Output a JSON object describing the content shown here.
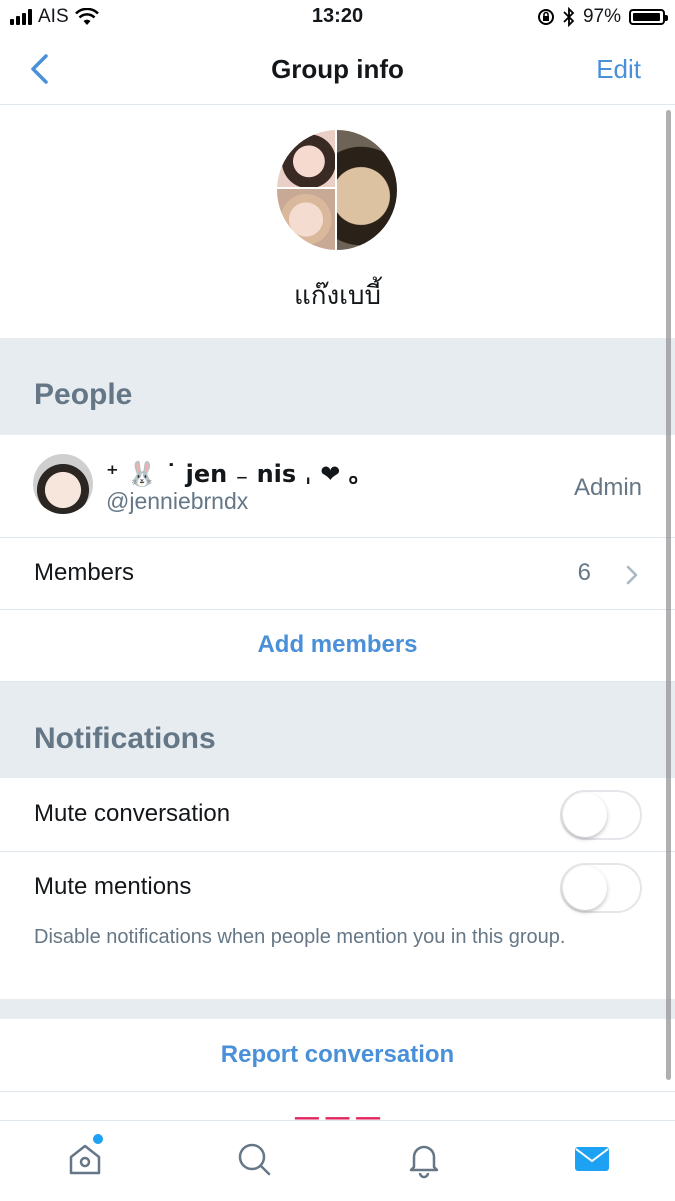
{
  "status_bar": {
    "carrier": "AIS",
    "time": "13:20",
    "battery": "97%"
  },
  "nav": {
    "title": "Group info",
    "edit_label": "Edit"
  },
  "group": {
    "name": "แก๊งเบบี้"
  },
  "people": {
    "section_title": "People",
    "admin": {
      "display_name": "⁺ 🐰 ˙ jen ₋ nis ˌ ❤︎ ｡",
      "handle": "@jenniebrndx",
      "role": "Admin"
    },
    "members_label": "Members",
    "members_count": "6",
    "add_members_label": "Add members"
  },
  "notifications": {
    "section_title": "Notifications",
    "mute_conversation_label": "Mute conversation",
    "mute_conversation_on": false,
    "mute_mentions_label": "Mute mentions",
    "mute_mentions_on": false,
    "mute_mentions_help": "Disable notifications when people mention you in this group."
  },
  "actions": {
    "report_label": "Report conversation"
  },
  "tabs": [
    "home-icon",
    "search-icon",
    "bell-icon",
    "mail-icon"
  ],
  "colors": {
    "accent": "#4a90d9",
    "section_bg": "#e6ecf0",
    "muted": "#657786",
    "danger": "#e0245e"
  }
}
